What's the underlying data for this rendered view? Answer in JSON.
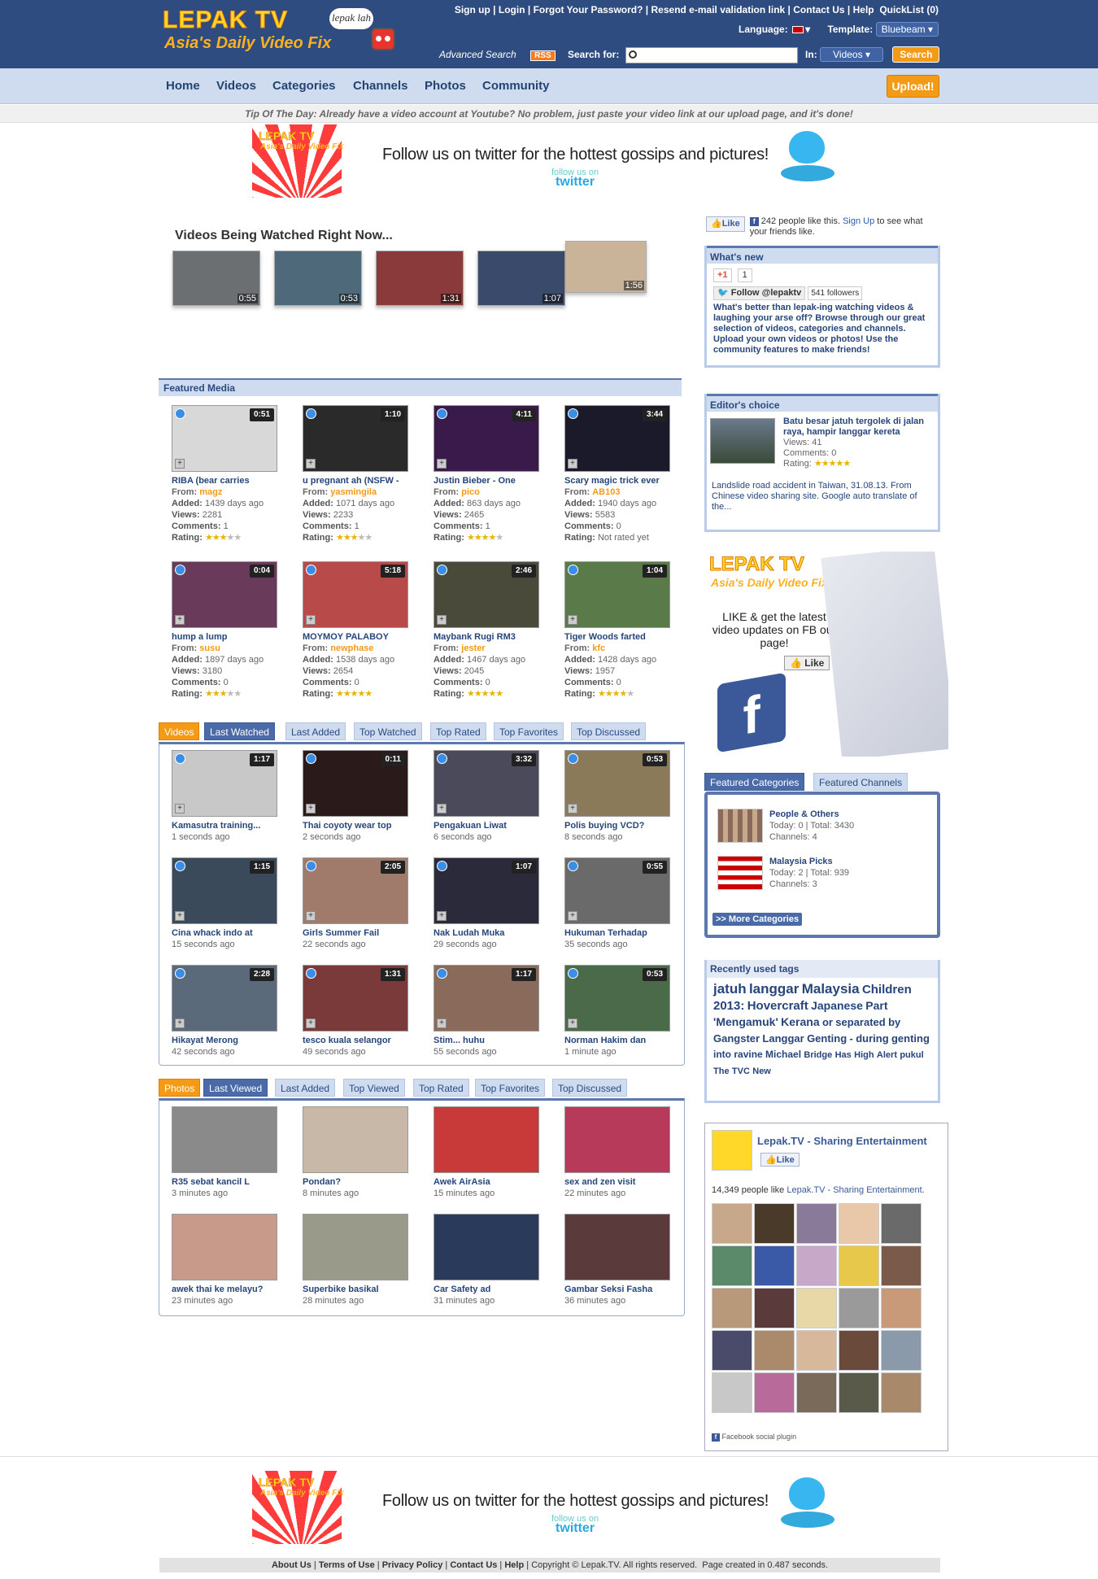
{
  "header": {
    "logo_main": "LEPAK TV",
    "logo_sub": "Asia's Daily Video Fix",
    "logo_bubble": "lepak lah",
    "top_links": [
      "Sign up",
      "Login",
      "Forgot Your Password?",
      "Resend e-mail validation link",
      "Contact Us",
      "Help"
    ],
    "quicklist": "QuickList (0)",
    "language_label": "Language:",
    "template_label": "Template:",
    "template_value": "Bluebeam",
    "advanced_search": "Advanced Search",
    "rss": "RSS",
    "search_for": "Search for:",
    "search_in": "In:",
    "search_in_value": "Videos",
    "search_button": "Search",
    "search_value": ""
  },
  "nav": {
    "items": [
      "Home",
      "Videos",
      "Categories",
      "Channels",
      "Photos",
      "Community"
    ],
    "upload": "Upload!"
  },
  "tip": "Tip Of The Day: Already have a video account at Youtube? No problem, just paste your video link at our upload page, and it's done!",
  "banner": {
    "text": "Follow us on twitter for the hottest gossips and pictures!",
    "follow": "follow us on",
    "twitter": "twitter",
    "logo": "LEPAK TV",
    "logo_sub": "Asia's Daily Video Fix"
  },
  "watching": {
    "title": "Videos Being Watched Right Now...",
    "items": [
      {
        "dur": "0:55",
        "color": "#6b6f72"
      },
      {
        "dur": "0:53",
        "color": "#4e6a7a"
      },
      {
        "dur": "1:31",
        "color": "#8a3a3a"
      },
      {
        "dur": "1:07",
        "color": "#3a4a6a"
      },
      {
        "dur": "1:56",
        "color": "#c9b49a"
      }
    ]
  },
  "featured": {
    "title": "Featured Media",
    "labels": {
      "from": "From:",
      "added": "Added:",
      "views": "Views:",
      "comments": "Comments:",
      "rating": "Rating:"
    },
    "items": [
      {
        "title": "RIBA (bear carries",
        "from": "magz",
        "added": "1439 days ago",
        "views": "2281",
        "comments": "1",
        "rating": 3,
        "rating_text": "",
        "dur": "0:51",
        "color": "#d8d8d8"
      },
      {
        "title": "u pregnant ah (NSFW -",
        "from": "yasmingila",
        "added": "1071 days ago",
        "views": "2233",
        "comments": "1",
        "rating": 3,
        "rating_text": "",
        "dur": "1:10",
        "color": "#2a2a2a"
      },
      {
        "title": "Justin Bieber - One",
        "from": "pico",
        "added": "863 days ago",
        "views": "2465",
        "comments": "1",
        "rating": 4,
        "rating_text": "",
        "dur": "4:11",
        "color": "#3a1a4a"
      },
      {
        "title": "Scary magic trick ever",
        "from": "AB103",
        "added": "1940 days ago",
        "views": "5583",
        "comments": "0",
        "rating": 0,
        "rating_text": "Not rated yet",
        "dur": "3:44",
        "color": "#1a1a2a"
      },
      {
        "title": "hump a lump",
        "from": "susu",
        "added": "1897 days ago",
        "views": "3180",
        "comments": "0",
        "rating": 3,
        "rating_text": "",
        "dur": "0:04",
        "color": "#6a3a5a"
      },
      {
        "title": "MOYMOY PALABOY",
        "from": "newphase",
        "added": "1538 days ago",
        "views": "2654",
        "comments": "0",
        "rating": 5,
        "rating_text": "",
        "dur": "5:18",
        "color": "#b84a4a"
      },
      {
        "title": "Maybank Rugi RM3",
        "from": "jester",
        "added": "1467 days ago",
        "views": "2045",
        "comments": "0",
        "rating": 5,
        "rating_text": "",
        "dur": "2:46",
        "color": "#4a4a3a"
      },
      {
        "title": "Tiger Woods farted",
        "from": "kfc",
        "added": "1428 days ago",
        "views": "1957",
        "comments": "0",
        "rating": 4,
        "rating_text": "",
        "dur": "1:04",
        "color": "#5a7a4a"
      }
    ]
  },
  "videos_tabs": [
    "Videos",
    "Last Watched",
    "Last Added",
    "Top Watched",
    "Top Rated",
    "Top Favorites",
    "Top Discussed"
  ],
  "videos": [
    {
      "title": "Kamasutra training...",
      "ago": "1 seconds ago",
      "dur": "1:17",
      "color": "#c8c8c8"
    },
    {
      "title": "Thai coyoty wear top",
      "ago": "2 seconds ago",
      "dur": "0:11",
      "color": "#2a1a1a"
    },
    {
      "title": "Pengakuan Liwat",
      "ago": "6 seconds ago",
      "dur": "3:32",
      "color": "#4a4a5a"
    },
    {
      "title": "Polis buying VCD?",
      "ago": "8 seconds ago",
      "dur": "0:53",
      "color": "#8a7a5a"
    },
    {
      "title": "Cina whack indo at",
      "ago": "15 seconds ago",
      "dur": "1:15",
      "color": "#3a4a5a"
    },
    {
      "title": "Girls Summer Fail",
      "ago": "22 seconds ago",
      "dur": "2:05",
      "color": "#a07a6a"
    },
    {
      "title": "Nak Ludah Muka",
      "ago": "29 seconds ago",
      "dur": "1:07",
      "color": "#2a2a3a"
    },
    {
      "title": "Hukuman Terhadap",
      "ago": "35 seconds ago",
      "dur": "0:55",
      "color": "#6a6a6a"
    },
    {
      "title": "Hikayat Merong",
      "ago": "42 seconds ago",
      "dur": "2:28",
      "color": "#5a6a7a"
    },
    {
      "title": "tesco kuala selangor",
      "ago": "49 seconds ago",
      "dur": "1:31",
      "color": "#7a3a3a"
    },
    {
      "title": "Stim... huhu",
      "ago": "55 seconds ago",
      "dur": "1:17",
      "color": "#8a6a5a"
    },
    {
      "title": "Norman Hakim dan",
      "ago": "1 minute ago",
      "dur": "0:53",
      "color": "#4a6a4a"
    }
  ],
  "photos_tabs": [
    "Photos",
    "Last Viewed",
    "Last Added",
    "Top Viewed",
    "Top Rated",
    "Top Favorites",
    "Top Discussed"
  ],
  "photos": [
    {
      "title": "R35 sebat kancil L",
      "ago": "3 minutes ago",
      "color": "#8a8a8a"
    },
    {
      "title": "Pondan?",
      "ago": "8 minutes ago",
      "color": "#c8b8a8"
    },
    {
      "title": "Awek AirAsia",
      "ago": "15 minutes ago",
      "color": "#c83a3a"
    },
    {
      "title": "sex and zen visit",
      "ago": "22 minutes ago",
      "color": "#b83a5a"
    },
    {
      "title": "awek thai ke melayu?",
      "ago": "23 minutes ago",
      "color": "#c89a8a"
    },
    {
      "title": "Superbike basikal",
      "ago": "28 minutes ago",
      "color": "#9a9a8a"
    },
    {
      "title": "Car Safety ad",
      "ago": "31 minutes ago",
      "color": "#2a3a5a"
    },
    {
      "title": "Gambar Seksi Fasha",
      "ago": "36 minutes ago",
      "color": "#5a3a3a"
    }
  ],
  "sidebar": {
    "fb_like": "Like",
    "fb_text": "242 people like this.",
    "fb_signup": "Sign Up",
    "fb_text2": "to see what your friends like.",
    "whats_new_title": "What's new",
    "gplus": "+1",
    "gplus_count": "1",
    "follow": "Follow @lepaktv",
    "followers": "541 followers",
    "whats_new_text": "What's better than lepak-ing watching videos & laughing your arse off? Browse through our great selection of videos, categories and channels. Upload your own videos or photos! Use the community features to make friends!",
    "editors_title": "Editor's choice",
    "editors_item_title": "Batu besar jatuh tergolek di jalan raya, hampir langgar kereta",
    "editors_views": "Views: 41",
    "editors_comments": "Comments: 0",
    "editors_rating_label": "Rating:",
    "editors_rating": 5,
    "editors_desc": "Landslide road accident in Taiwan, 31.08.13. From Chinese video sharing site. Google auto translate of the...",
    "fb_ad_logo": "LEPAK TV",
    "fb_ad_logo_sub": "Asia's Daily Video Fix",
    "fb_ad_text": "LIKE & get the latest video updates on FB our page!",
    "fb_ad_like": "Like",
    "cat_tabs": [
      "Featured Categories",
      "Featured Channels"
    ],
    "cats": [
      {
        "name": "People & Others",
        "stats": "Today: 0 | Total: 3430",
        "channels": "Channels: 4"
      },
      {
        "name": "Malaysia Picks",
        "stats": "Today: 2 | Total: 939",
        "channels": "Channels: 3"
      }
    ],
    "more_cats": ">> More Categories",
    "tags_title": "Recently used tags",
    "tags": [
      {
        "t": "jatuh",
        "s": 17
      },
      {
        "t": "langgar",
        "s": 17
      },
      {
        "t": "Malaysia",
        "s": 17
      },
      {
        "t": "Children",
        "s": 15
      },
      {
        "t": "2013:",
        "s": 15
      },
      {
        "t": "Hovercraft",
        "s": 15
      },
      {
        "t": "Japanese",
        "s": 14
      },
      {
        "t": "Part",
        "s": 14
      },
      {
        "t": "'Mengamuk'",
        "s": 14
      },
      {
        "t": "Kerana",
        "s": 14
      },
      {
        "t": "or",
        "s": 13
      },
      {
        "t": "separated",
        "s": 13
      },
      {
        "t": "by",
        "s": 13
      },
      {
        "t": "Gangster",
        "s": 13
      },
      {
        "t": "Langgar",
        "s": 13
      },
      {
        "t": "Genting",
        "s": 13
      },
      {
        "t": "-",
        "s": 13
      },
      {
        "t": "during",
        "s": 13
      },
      {
        "t": "genting",
        "s": 13
      },
      {
        "t": "into",
        "s": 12
      },
      {
        "t": "ravine",
        "s": 12
      },
      {
        "t": "Michael",
        "s": 12
      },
      {
        "t": "Bridge",
        "s": 11
      },
      {
        "t": "Has",
        "s": 11
      },
      {
        "t": "High",
        "s": 11
      },
      {
        "t": "Alert",
        "s": 11
      },
      {
        "t": "pukul",
        "s": 11
      },
      {
        "t": "The",
        "s": 11
      },
      {
        "t": "TVC",
        "s": 11
      },
      {
        "t": "New",
        "s": 11
      }
    ],
    "fbbox_title": "Lepak.TV - Sharing Entertainment",
    "fbbox_like": "Like",
    "fbbox_count": "14,349 people like",
    "fbbox_link": "Lepak.TV - Sharing Entertainment",
    "fbbox_plugin": "Facebook social plugin"
  },
  "footer": {
    "links": [
      "About Us",
      "Terms of Use",
      "Privacy Policy",
      "Contact Us",
      "Help"
    ],
    "copyright": "Copyright © Lepak.TV. All rights reserved.",
    "created": "Page created in 0.487 seconds."
  }
}
